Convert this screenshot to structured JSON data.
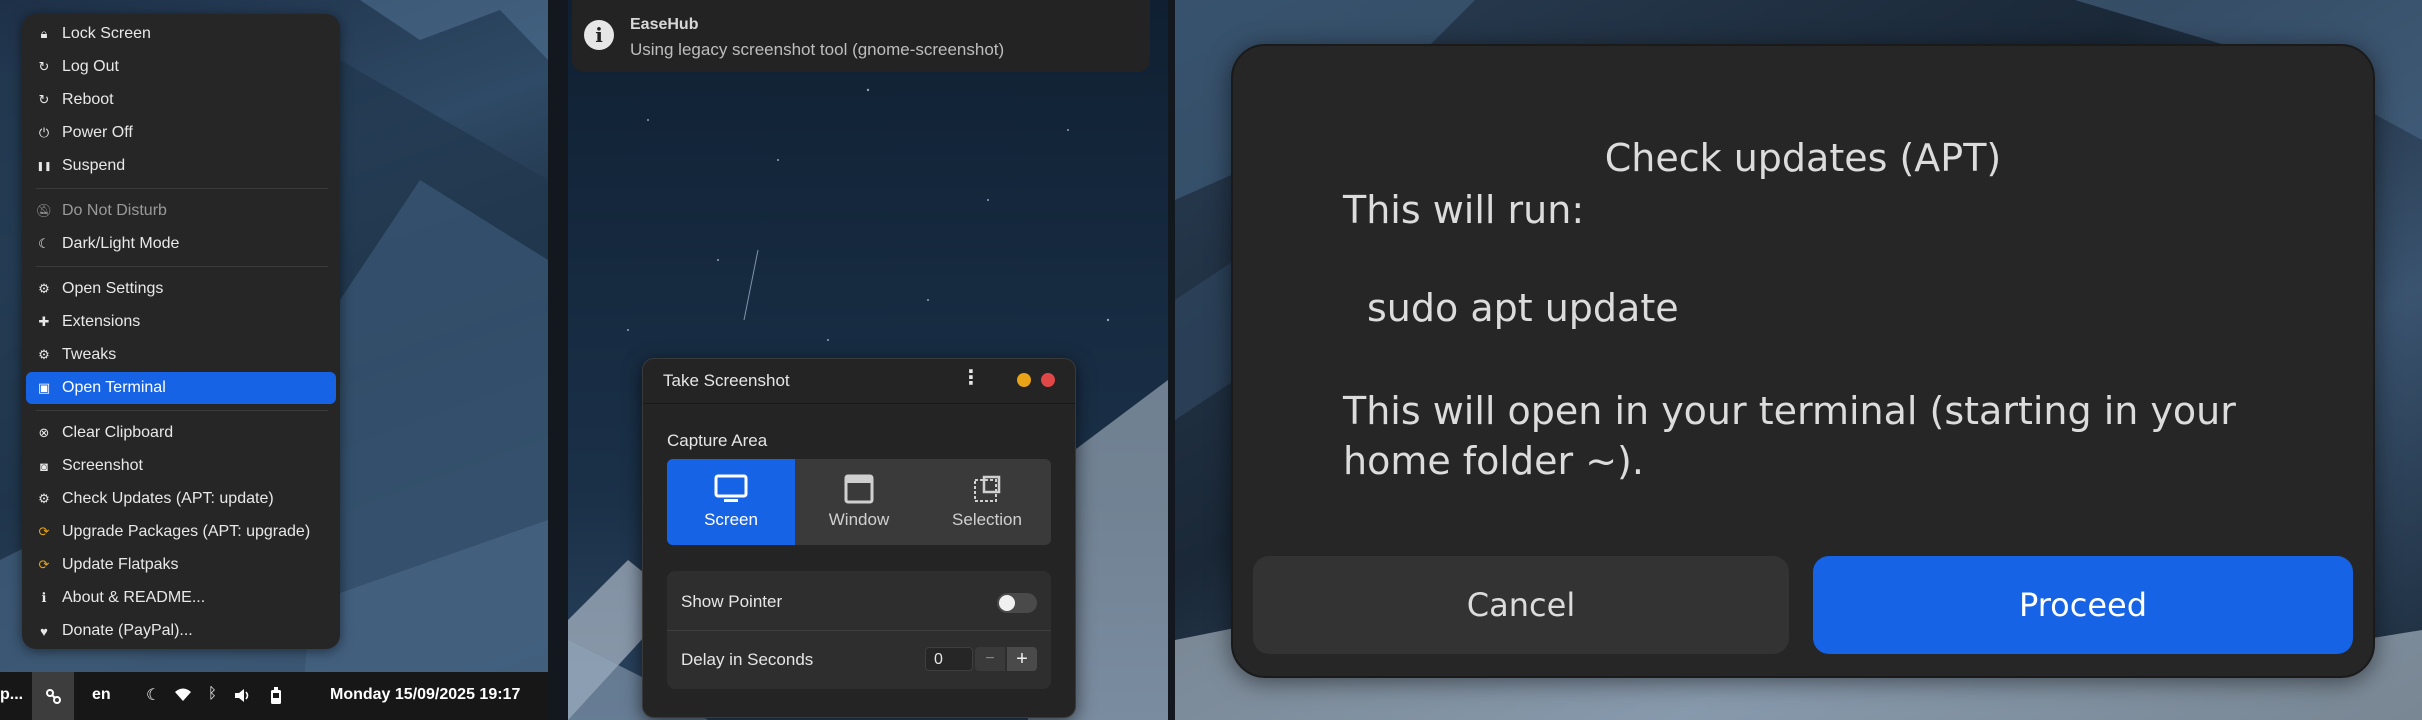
{
  "menu": {
    "items": [
      {
        "label": "Lock Screen",
        "icon": "lock-icon",
        "glyph": "🔒︎"
      },
      {
        "label": "Log Out",
        "icon": "logout-icon",
        "glyph": "↻"
      },
      {
        "label": "Reboot",
        "icon": "reboot-icon",
        "glyph": "↻"
      },
      {
        "label": "Power Off",
        "icon": "power-icon",
        "glyph": "⏻"
      },
      {
        "label": "Suspend",
        "icon": "pause-icon",
        "glyph": "❚❚"
      },
      {
        "label": "Do Not Disturb",
        "icon": "bell-off-icon",
        "glyph": "🔕︎"
      },
      {
        "label": "Dark/Light Mode",
        "icon": "moon-icon",
        "glyph": "☾"
      },
      {
        "label": "Open Settings",
        "icon": "gear-icon",
        "glyph": "⚙"
      },
      {
        "label": "Extensions",
        "icon": "puzzle-icon",
        "glyph": "✚"
      },
      {
        "label": "Tweaks",
        "icon": "gear-icon",
        "glyph": "⚙"
      },
      {
        "label": "Open Terminal",
        "icon": "terminal-icon",
        "glyph": "▣"
      },
      {
        "label": "Clear Clipboard",
        "icon": "clear-icon",
        "glyph": "⊗"
      },
      {
        "label": "Screenshot",
        "icon": "camera-icon",
        "glyph": "◙"
      },
      {
        "label": "Check Updates (APT: update)",
        "icon": "gear-icon",
        "glyph": "⚙"
      },
      {
        "label": "Upgrade Packages (APT: upgrade)",
        "icon": "update-warning-icon",
        "glyph": "⟳"
      },
      {
        "label": "Update Flatpaks",
        "icon": "update-warning-icon",
        "glyph": "⟳"
      },
      {
        "label": "About & README...",
        "icon": "info-icon",
        "glyph": "ℹ"
      },
      {
        "label": "Donate (PayPal)...",
        "icon": "heart-icon",
        "glyph": "♥"
      }
    ]
  },
  "taskbar": {
    "app_label": "p...",
    "lang": "en",
    "datetime": "Monday 15/09/2025 19:17"
  },
  "notification": {
    "title": "EaseHub",
    "body": "Using legacy screenshot tool (gnome-screenshot)"
  },
  "screenshot_dialog": {
    "title": "Take Screenshot",
    "capture_area_label": "Capture Area",
    "modes": [
      {
        "label": "Screen",
        "selected": true
      },
      {
        "label": "Window",
        "selected": false
      },
      {
        "label": "Selection",
        "selected": false
      }
    ],
    "show_pointer_label": "Show Pointer",
    "show_pointer_on": false,
    "delay_label": "Delay in Seconds",
    "delay_value": "0",
    "minus": "−",
    "plus": "+"
  },
  "apt_dialog": {
    "title": "Check updates (APT)",
    "line1": "This will run:",
    "command": "sudo apt update",
    "line2": "This will open in your terminal (starting in your home folder ~).",
    "cancel_label": "Cancel",
    "proceed_label": "Proceed"
  },
  "colors": {
    "accent": "#1763e6",
    "warning": "#e8a317",
    "close": "#e04848",
    "minimize": "#e8a317"
  }
}
